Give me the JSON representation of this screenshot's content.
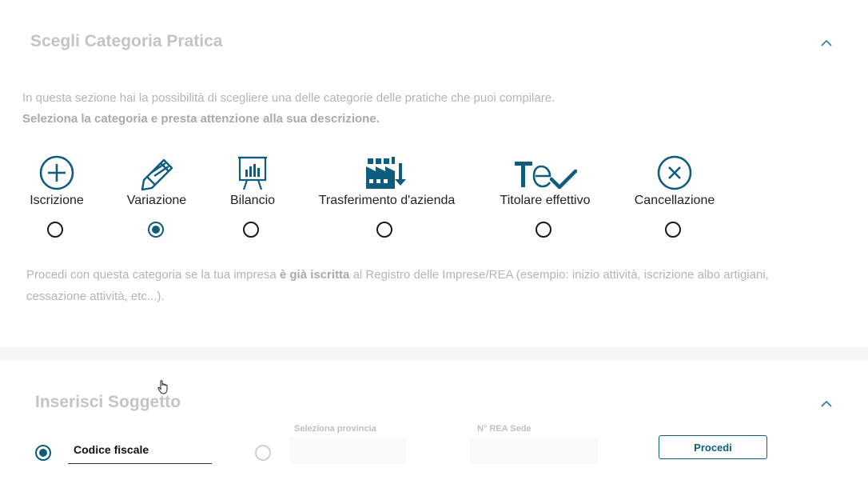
{
  "section_category": {
    "title": "Scegli Categoria Pratica",
    "intro_line1": "In questa sezione hai la possibilità di scegliere una delle categorie delle pratiche che puoi compilare.",
    "intro_line2": "Seleziona la categoria e presta attenzione alla sua descrizione.",
    "categories": [
      {
        "label": "Iscrizione",
        "icon": "plus-circle-icon",
        "selected": false
      },
      {
        "label": "Variazione",
        "icon": "pencil-icon",
        "selected": true
      },
      {
        "label": "Bilancio",
        "icon": "presentation-chart-icon",
        "selected": false
      },
      {
        "label": "Trasferimento d'azienda",
        "icon": "factory-transfer-icon",
        "selected": false
      },
      {
        "label": "Titolare effettivo",
        "icon": "text-check-icon",
        "selected": false
      },
      {
        "label": "Cancellazione",
        "icon": "x-circle-icon",
        "selected": false
      }
    ],
    "description": {
      "part1": "Procedi con questa categoria se la tua impresa ",
      "bold": "è già iscritta",
      "part2": " al Registro delle Imprese/REA (esempio: inizio attività, iscrizione albo artigiani, cessazione attività, etc...)."
    }
  },
  "section_subject": {
    "title": "Inserisci Soggetto",
    "codice_fiscale_label": "Codice fiscale",
    "provincia_label": "Seleziona provincia",
    "rea_label": "N° REA Sede",
    "procedi_label": "Procedi",
    "selected_option": "codice-fiscale"
  },
  "colors": {
    "accent": "#0f5d7e",
    "muted_text": "#b5b5b5"
  }
}
